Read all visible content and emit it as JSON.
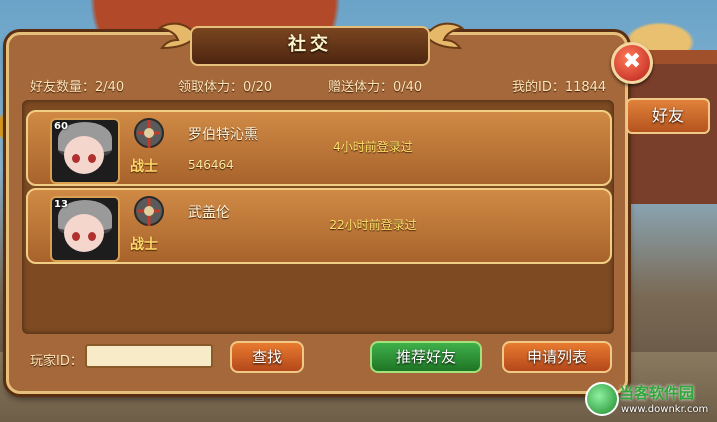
{
  "dialog": {
    "title": "社交",
    "close_label": "✖"
  },
  "stats": {
    "friend_count": "好友数量：2/40",
    "claim_stamina": "领取体力：0/20",
    "gift_stamina": "赠送体力：0/40",
    "my_id": "我的ID：11844"
  },
  "friends": [
    {
      "level": "60",
      "class": "战士",
      "name": "罗伯特沁熏",
      "id": "546464",
      "last_login": "4小时前登录过"
    },
    {
      "level": "13",
      "class": "战士",
      "name": "武盖伦",
      "id": "",
      "last_login": "22小时前登录过"
    }
  ],
  "search": {
    "label": "玩家ID：",
    "value": "",
    "search_button": "查找",
    "recommend_button": "推荐好友",
    "requests_button": "申请列表"
  },
  "side_tabs": [
    "好友"
  ],
  "watermark": {
    "name": "当客软件园",
    "url": "www.downkr.com"
  },
  "colors": {
    "panel": "#a4683a",
    "border": "#e6c07a",
    "accent_orange": "#d8702a",
    "accent_green": "#2e9a3a"
  }
}
